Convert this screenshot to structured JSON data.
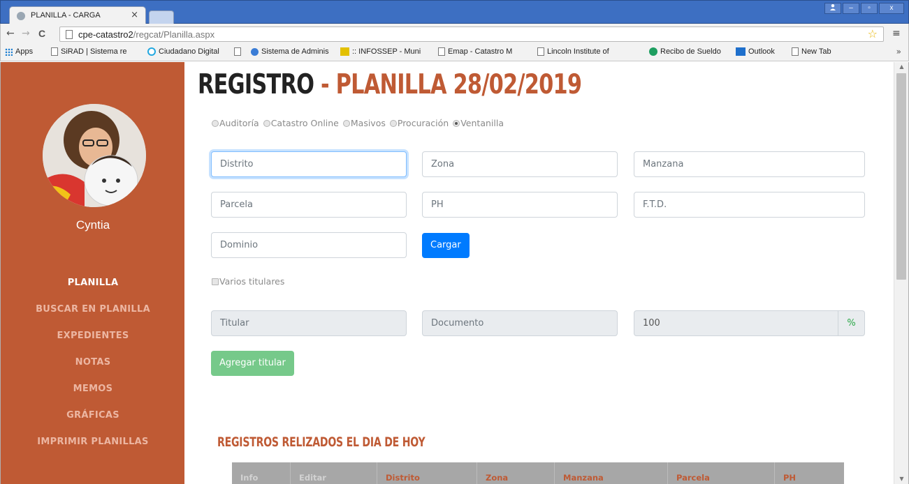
{
  "browser": {
    "tab_title": "PLANILLA - CARGA",
    "tab_close": "×",
    "url_host": "cpe-catastro2",
    "url_path": "/regcat/Planilla.aspx",
    "nav": {
      "back": "←",
      "forward": "→",
      "reload": "C"
    },
    "menu_icon": "≡",
    "star_icon": "☆",
    "window_controls": {
      "user": "👤",
      "minimize": "–",
      "maximize": "▫",
      "close": "x"
    },
    "bookmarks": [
      {
        "label": "Apps",
        "icon": "apps-grid-icon"
      },
      {
        "label": "SiRAD | Sistema re",
        "icon": "page-icon"
      },
      {
        "label": "Ciudadano Digital",
        "icon": "circle-icon"
      },
      {
        "label": "",
        "icon": "page-icon"
      },
      {
        "label": "Sistema de Adminis",
        "icon": "globe-icon"
      },
      {
        "label": ":: INFOSSEP - Muni",
        "icon": "infossep-icon"
      },
      {
        "label": "Emap - Catastro M",
        "icon": "page-icon"
      },
      {
        "label": "Lincoln Institute of",
        "icon": "page-icon"
      },
      {
        "label": "Recibo de Sueldo",
        "icon": "recibo-icon"
      },
      {
        "label": "Outlook",
        "icon": "outlook-icon"
      },
      {
        "label": "New Tab",
        "icon": "page-icon"
      }
    ],
    "bookmarks_more": "»"
  },
  "sidebar": {
    "username": "Cyntia",
    "items": [
      {
        "label": "PLANILLA",
        "active": true
      },
      {
        "label": "BUSCAR EN PLANILLA",
        "active": false
      },
      {
        "label": "EXPEDIENTES",
        "active": false
      },
      {
        "label": "NOTAS",
        "active": false
      },
      {
        "label": "MEMOS",
        "active": false
      },
      {
        "label": "GRÁFICAS",
        "active": false
      },
      {
        "label": "IMPRIMIR PLANILLAS",
        "active": false
      }
    ],
    "colors": {
      "background": "#bf5a34",
      "active_text": "#ffffff",
      "inactive_text": "#ecb6a2"
    }
  },
  "main": {
    "title_part1": "REGISTRO",
    "title_part2": " - PLANILLA 28/02/2019",
    "radio_options": [
      {
        "label": "Auditoría",
        "checked": false
      },
      {
        "label": "Catastro Online",
        "checked": false
      },
      {
        "label": "Masivos",
        "checked": false
      },
      {
        "label": "Procuración",
        "checked": false
      },
      {
        "label": "Ventanilla",
        "checked": true
      }
    ],
    "fields": {
      "distrito": {
        "placeholder": "Distrito",
        "value": ""
      },
      "zona": {
        "placeholder": "Zona",
        "value": ""
      },
      "manzana": {
        "placeholder": "Manzana",
        "value": ""
      },
      "parcela": {
        "placeholder": "Parcela",
        "value": ""
      },
      "ph": {
        "placeholder": "PH",
        "value": ""
      },
      "ftd": {
        "placeholder": "F.T.D.",
        "value": ""
      },
      "dominio": {
        "placeholder": "Dominio",
        "value": ""
      },
      "titular": {
        "placeholder": "Titular",
        "value": ""
      },
      "documento": {
        "placeholder": "Documento",
        "value": ""
      },
      "porcentaje": {
        "value": "100",
        "addon": "%"
      }
    },
    "cargar_label": "Cargar",
    "varios_titulares_label": "Varios titulares",
    "agregar_titular_label": "Agregar titular",
    "section_title": "REGISTROS RELIZADOS EL DIA DE HOY",
    "table_headers": [
      "Info",
      "Editar",
      "Distrito",
      "Zona",
      "Manzana",
      "Parcela",
      "PH"
    ],
    "colors": {
      "accent": "#bf5a34",
      "primary": "#007bff",
      "success": "#76c98a",
      "table_header": "#a7a7a7"
    }
  }
}
